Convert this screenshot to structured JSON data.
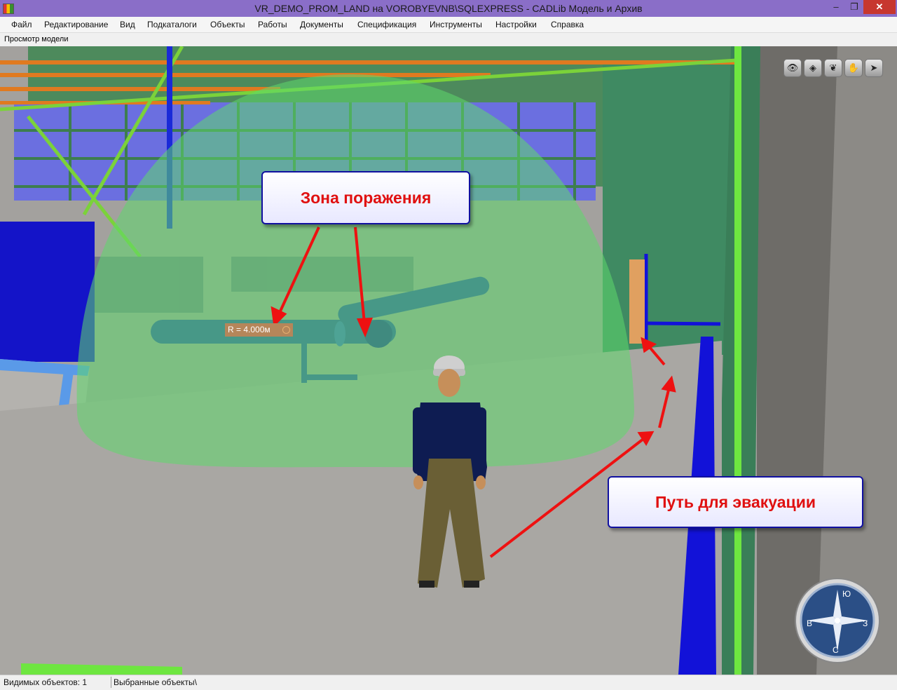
{
  "window": {
    "title": "VR_DEMO_PROM_LAND на VOROBYEVNB\\SQLEXPRESS - CADLib Модель и Архив",
    "minimize_glyph": "–",
    "maximize_glyph": "❐",
    "close_glyph": "✕"
  },
  "menu": [
    "Файл",
    "Редактирование",
    "Вид",
    "Подкаталоги",
    "Объекты",
    "Работы",
    "Документы",
    "Спецификация",
    "Инструменты",
    "Настройки",
    "Справка"
  ],
  "panel": {
    "caption": "Просмотр модели"
  },
  "viewport": {
    "callout_zone": "Зона поражения",
    "callout_path": "Путь для эвакуации",
    "radius_label": "R = 4.000м",
    "toolbar_icons": [
      "eye-icon",
      "cube-icon",
      "globe-icon",
      "hand-icon",
      "plane-icon"
    ],
    "toolbar_glyphs": [
      "👁",
      "◈",
      "❦",
      "✋",
      "➤"
    ],
    "compass": {
      "north": "Ю",
      "east": "З",
      "south": "С",
      "west": "В"
    },
    "colors": {
      "zone": "#5ed86c",
      "arrow": "#ee1111",
      "path": "#1212d8",
      "callout_text": "#e01010"
    }
  },
  "status": {
    "visible_objects": "Видимых объектов: 1",
    "selected_objects": "Выбранные объекты\\"
  }
}
